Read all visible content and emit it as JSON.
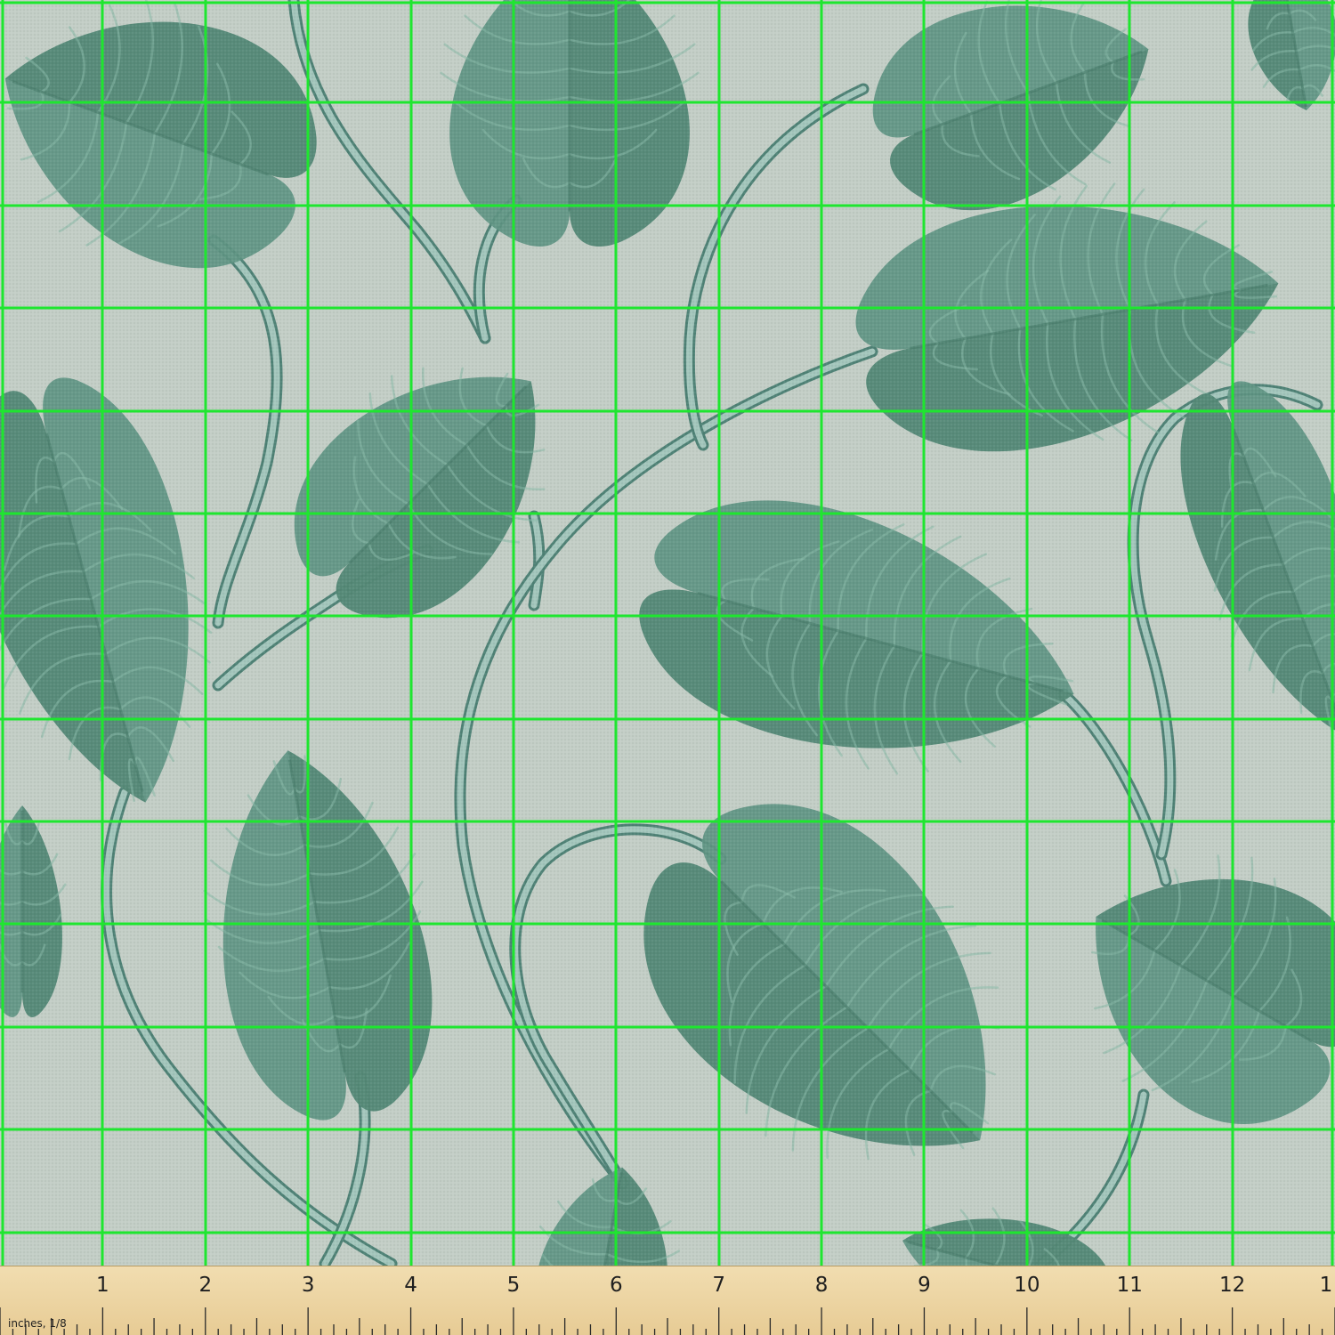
{
  "colors": {
    "background": "#c3cec6",
    "leaf_light": "#5f9583",
    "leaf_dark": "#4c7f6d",
    "vein": "#86b8a5",
    "stem": "#4f8276",
    "stem_highlight": "#a3c6bc",
    "grid": "#1ee62f",
    "ruler": "#ecd4a2"
  },
  "grid": {
    "divisions": 13,
    "unit": "inch"
  },
  "ruler": {
    "unit_label": "inches, 1/8",
    "numbers": [
      "1",
      "2",
      "3",
      "4",
      "5",
      "6",
      "7",
      "8",
      "9",
      "10",
      "11",
      "12",
      "1"
    ]
  }
}
